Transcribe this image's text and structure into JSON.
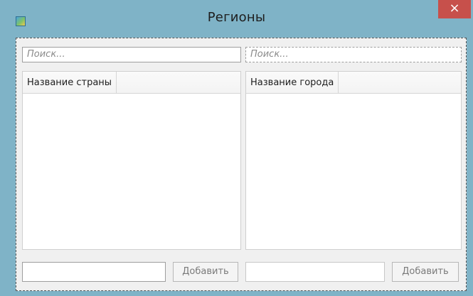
{
  "window": {
    "title": "Регионы",
    "close_label": "×"
  },
  "countries": {
    "search_placeholder": "Поиск...",
    "column_header": "Название страны",
    "add_label": "Добавить",
    "rows": []
  },
  "cities": {
    "search_placeholder": "Поиск...",
    "column_header": "Название города",
    "add_label": "Добавить",
    "rows": []
  }
}
